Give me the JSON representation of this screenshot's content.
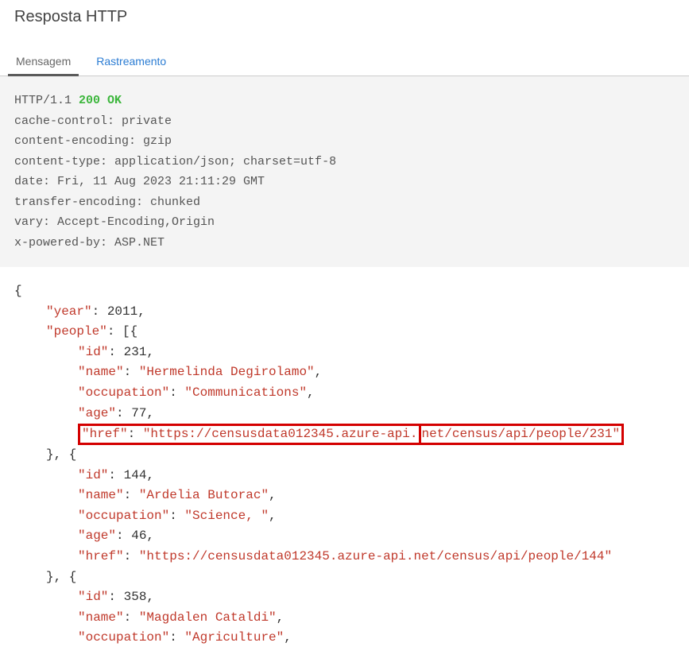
{
  "title": "Resposta HTTP",
  "tabs": {
    "message": "Mensagem",
    "trace": "Rastreamento"
  },
  "http": {
    "proto": "HTTP/1.1 ",
    "status": "200 OK",
    "headers": {
      "cache_control": "cache-control: private",
      "content_encoding": "content-encoding: gzip",
      "content_type": "content-type: application/json; charset=utf-8",
      "date": "date: Fri, 11 Aug 2023 21:11:29 GMT",
      "transfer_encoding": "transfer-encoding: chunked",
      "vary": "vary: Accept-Encoding,Origin",
      "x_powered_by": "x-powered-by: ASP.NET"
    }
  },
  "body": {
    "year_key": "\"year\"",
    "year_val": "2011",
    "people_key": "\"people\"",
    "items": [
      {
        "id_key": "\"id\"",
        "id_val": "231",
        "name_key": "\"name\"",
        "name_val": "\"Hermelinda Degirolamo\"",
        "occ_key": "\"occupation\"",
        "occ_val": "\"Communications\"",
        "age_key": "\"age\"",
        "age_val": "77",
        "href_key": "\"href\"",
        "href_left": "\"https://censusdata012345.azure-api.",
        "href_right": "net/census/api/people/231\"",
        "highlighted": true
      },
      {
        "id_key": "\"id\"",
        "id_val": "144",
        "name_key": "\"name\"",
        "name_val": "\"Ardelia Butorac\"",
        "occ_key": "\"occupation\"",
        "occ_val": "\"Science, \"",
        "age_key": "\"age\"",
        "age_val": "46",
        "href_key": "\"href\"",
        "href_val": "\"https://censusdata012345.azure-api.net/census/api/people/144\"",
        "highlighted": false
      },
      {
        "id_key": "\"id\"",
        "id_val": "358",
        "name_key": "\"name\"",
        "name_val": "\"Magdalen Cataldi\"",
        "occ_key": "\"occupation\"",
        "occ_val": "\"Agriculture\"",
        "partial": true
      }
    ]
  },
  "punct": {
    "colon_sp": ": ",
    "comma": ",",
    "open_obj": "{",
    "close_open": "}, {",
    "open_arr": "[{"
  }
}
